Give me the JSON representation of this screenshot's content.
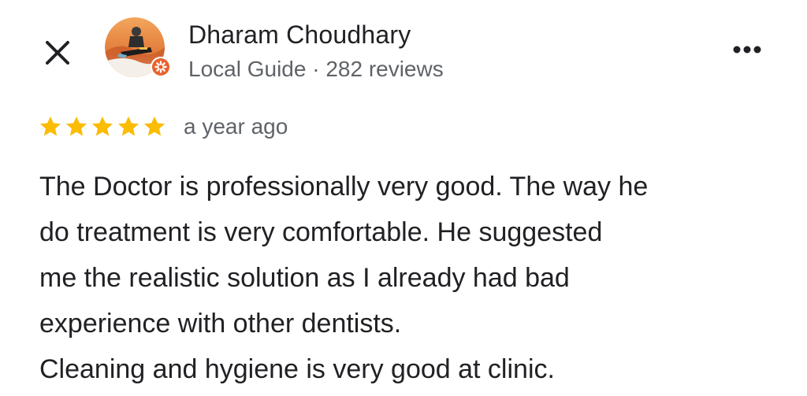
{
  "header": {
    "close_icon": "close-icon",
    "more_icon": "more-horizontal-icon"
  },
  "reviewer": {
    "name": "Dharam Choudhary",
    "meta": "Local Guide · 282 reviews",
    "avatar_icon": "avatar-photo",
    "badge_icon": "local-guide-badge-icon",
    "badge_color": "#e8622c"
  },
  "review": {
    "rating": 5,
    "max_rating": 5,
    "star_color": "#fbbc04",
    "date": "a year ago",
    "lines": [
      "The Doctor is professionally very good. The way he",
      "do treatment is very comfortable. He suggested",
      "me the realistic solution as I already had bad",
      "experience with other dentists.",
      "Cleaning and hygiene is very good at clinic."
    ]
  }
}
